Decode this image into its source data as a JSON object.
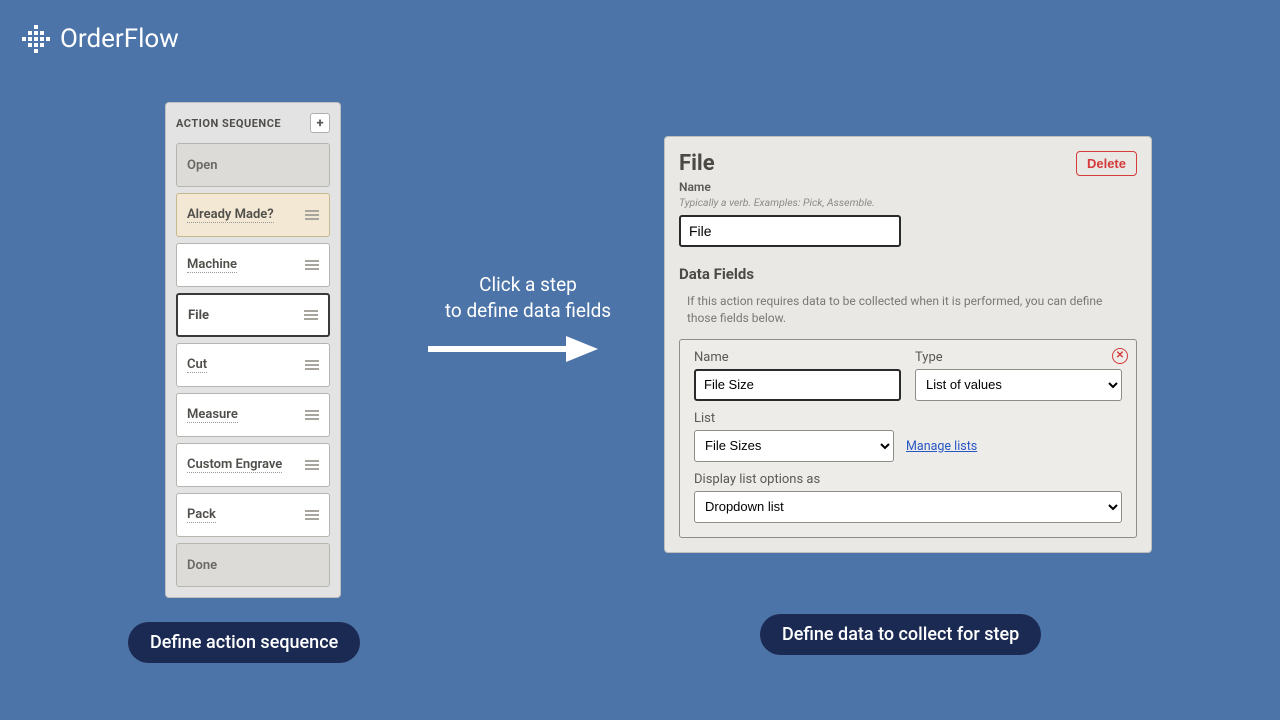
{
  "brand": {
    "name": "OrderFlow"
  },
  "sequence": {
    "title": "ACTION SEQUENCE",
    "add_label": "+",
    "steps": [
      {
        "label": "Open",
        "variant": "disabled"
      },
      {
        "label": "Already Made?",
        "variant": "diamond"
      },
      {
        "label": "Machine",
        "variant": "normal"
      },
      {
        "label": "File",
        "variant": "selected"
      },
      {
        "label": "Cut",
        "variant": "normal"
      },
      {
        "label": "Measure",
        "variant": "normal"
      },
      {
        "label": "Custom Engrave",
        "variant": "normal"
      },
      {
        "label": "Pack",
        "variant": "normal"
      },
      {
        "label": "Done",
        "variant": "disabled"
      }
    ]
  },
  "instruction": {
    "line1": "Click a step",
    "line2": "to define data fields"
  },
  "detail": {
    "heading": "File",
    "delete_label": "Delete",
    "name_label": "Name",
    "name_hint_prefix": "Typically a verb. Examples: ",
    "name_hint_examples": "Pick, Assemble.",
    "name_value": "File",
    "data_fields_heading": "Data Fields",
    "data_fields_desc": "If this action requires data to be collected when it is performed, you can define those fields below.",
    "field": {
      "name_label": "Name",
      "name_value": "File Size",
      "type_label": "Type",
      "type_value": "List of values",
      "list_label": "List",
      "list_value": "File Sizes",
      "manage_label": "Manage lists",
      "display_label": "Display list options as",
      "display_value": "Dropdown list"
    }
  },
  "captions": {
    "left": "Define action sequence",
    "right": "Define data to collect for step"
  }
}
